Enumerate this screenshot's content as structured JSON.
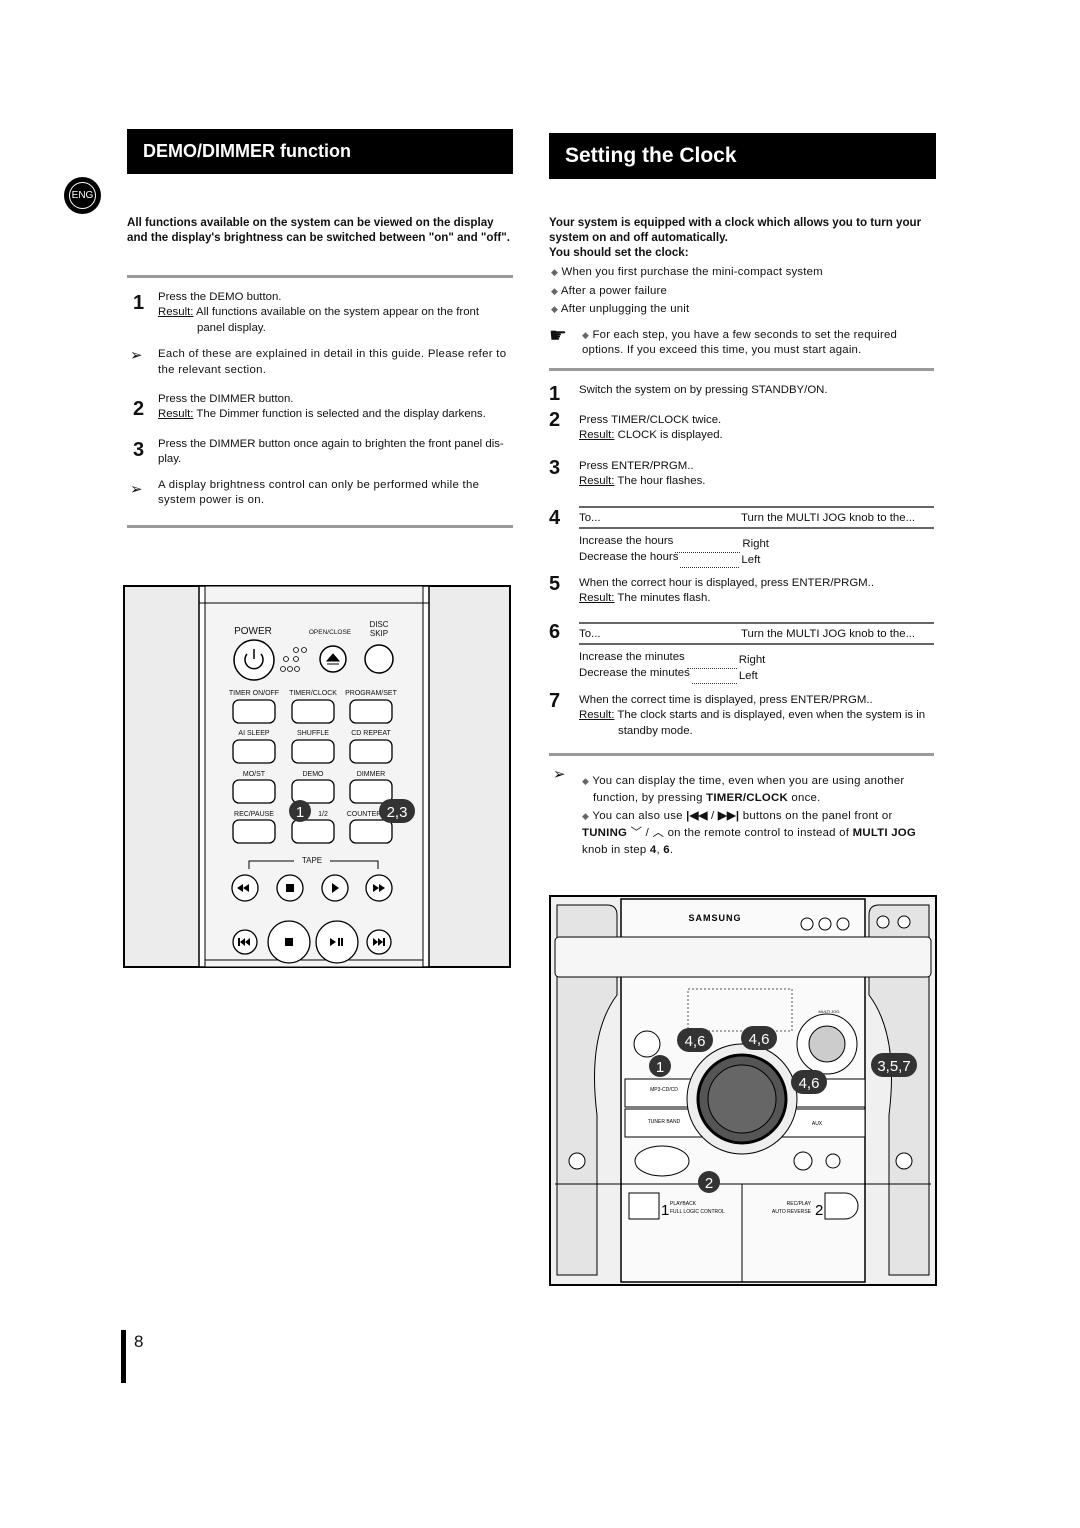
{
  "lang_badge": "ENG",
  "left": {
    "title": "DEMO/DIMMER function",
    "intro": "All functions available on the system can be viewed on the display and the display's  brightness can be switched between \"on\" and \"off\".",
    "steps": [
      {
        "n": "1",
        "text": "Press the DEMO button.",
        "result_label": "Result:",
        "result": "All functions available on the system appear on the front",
        "result2": "panel display."
      },
      {
        "n": "2",
        "text": "Press the DIMMER button.",
        "result_label": "Result:",
        "result": "The Dimmer function is selected and the display darkens."
      },
      {
        "n": "3",
        "text": "Press the DIMMER button once again to brighten the front panel dis-",
        "text2": "play."
      }
    ],
    "notes": [
      "Each of these are explained in detail in this guide. Please refer to the relevant section.",
      "A display brightness control can only be performed while the system power is on."
    ]
  },
  "remote": {
    "labels": {
      "power": "POWER",
      "open_close": "OPEN/CLOSE",
      "disc_skip_1": "DISC",
      "disc_skip_2": "SKIP",
      "timer_onoff": "TIMER ON/OFF",
      "timer_clock": "TIMER/CLOCK",
      "program_set": "PROGRAM/SET",
      "ai_sleep": "AI SLEEP",
      "shuffle": "SHUFFLE",
      "cd_repeat": "CD REPEAT",
      "mo_st": "MO/ST",
      "demo": "DEMO",
      "dimmer": "DIMMER",
      "rec_pause": "REC/PAUSE",
      "half": "1/2",
      "counter": "COUNTER",
      "tape": "TAPE"
    },
    "callouts": [
      "1",
      "2,3"
    ]
  },
  "right": {
    "title": "Setting the Clock",
    "intro": "Your system is equipped with a clock which allows you to turn your system on and off automatically.",
    "intro2": "You should set the clock:",
    "bullets": [
      "When you first purchase the mini-compact system",
      "After a power failure",
      "After unplugging the unit"
    ],
    "hand_note": "For each step, you have a few seconds to set the required options. If you exceed this time, you must start again.",
    "steps": {
      "s1": "Switch the system on by pressing STANDBY/ON.",
      "s2": "Press TIMER/CLOCK  twice.",
      "s2r": "CLOCK  is displayed.",
      "s3": "Press ENTER/PRGM..",
      "s3r": "The hour flashes.",
      "s5": "When the correct hour is displayed, press ENTER/PRGM..",
      "s5r": "The minutes flash.",
      "s7": "When the correct time is displayed, press ENTER/PRGM..",
      "s7r": "The clock starts and is displayed, even when the system is in",
      "s7r2": "standby mode.",
      "result_label": "Result:"
    },
    "table_hours": {
      "col1": "To...",
      "col2": "Turn the  MULTI JOG knob to the...",
      "rows": [
        [
          "Increase the hours",
          "Right"
        ],
        [
          "Decrease the hours",
          "Left"
        ]
      ]
    },
    "table_minutes": {
      "col1": "To...",
      "col2": "Turn the  MULTI JOG knob to the...",
      "rows": [
        [
          "Increase the minutes",
          "Right"
        ],
        [
          "Decrease the minutes",
          "Left"
        ]
      ]
    },
    "notes": {
      "n1a": "You can display the time, even when you are using another function, by pressing ",
      "n1b": "TIMER/CLOCK",
      "n1c": " once.",
      "n2a": "You can also use ",
      "n2b": " buttons on the panel front or ",
      "n2c": "TUNING",
      "n2d": " on the remote control to instead of ",
      "n2e": "MULTI JOG",
      "n2f": " knob in step ",
      "n2g": "4",
      "n2h": ", ",
      "n2i": "6",
      "n2j": "."
    }
  },
  "device": {
    "brand": "SAMSUNG",
    "multi_jog": "MULTI JOG",
    "mp3": "MP3-CD/CD",
    "tuner": "TUNER BAND",
    "aux": "AUX",
    "playback_1": "1",
    "playback": "PLAYBACK",
    "flc": "FULL LOGIC CONTROL",
    "recplay": "REC/PLAY",
    "auto_rev": "AUTO  REVERSE",
    "deck2": "2",
    "callouts": [
      "4,6",
      "4,6",
      "1",
      "4,6",
      "3,5,7",
      "2"
    ]
  },
  "page_number": "8"
}
